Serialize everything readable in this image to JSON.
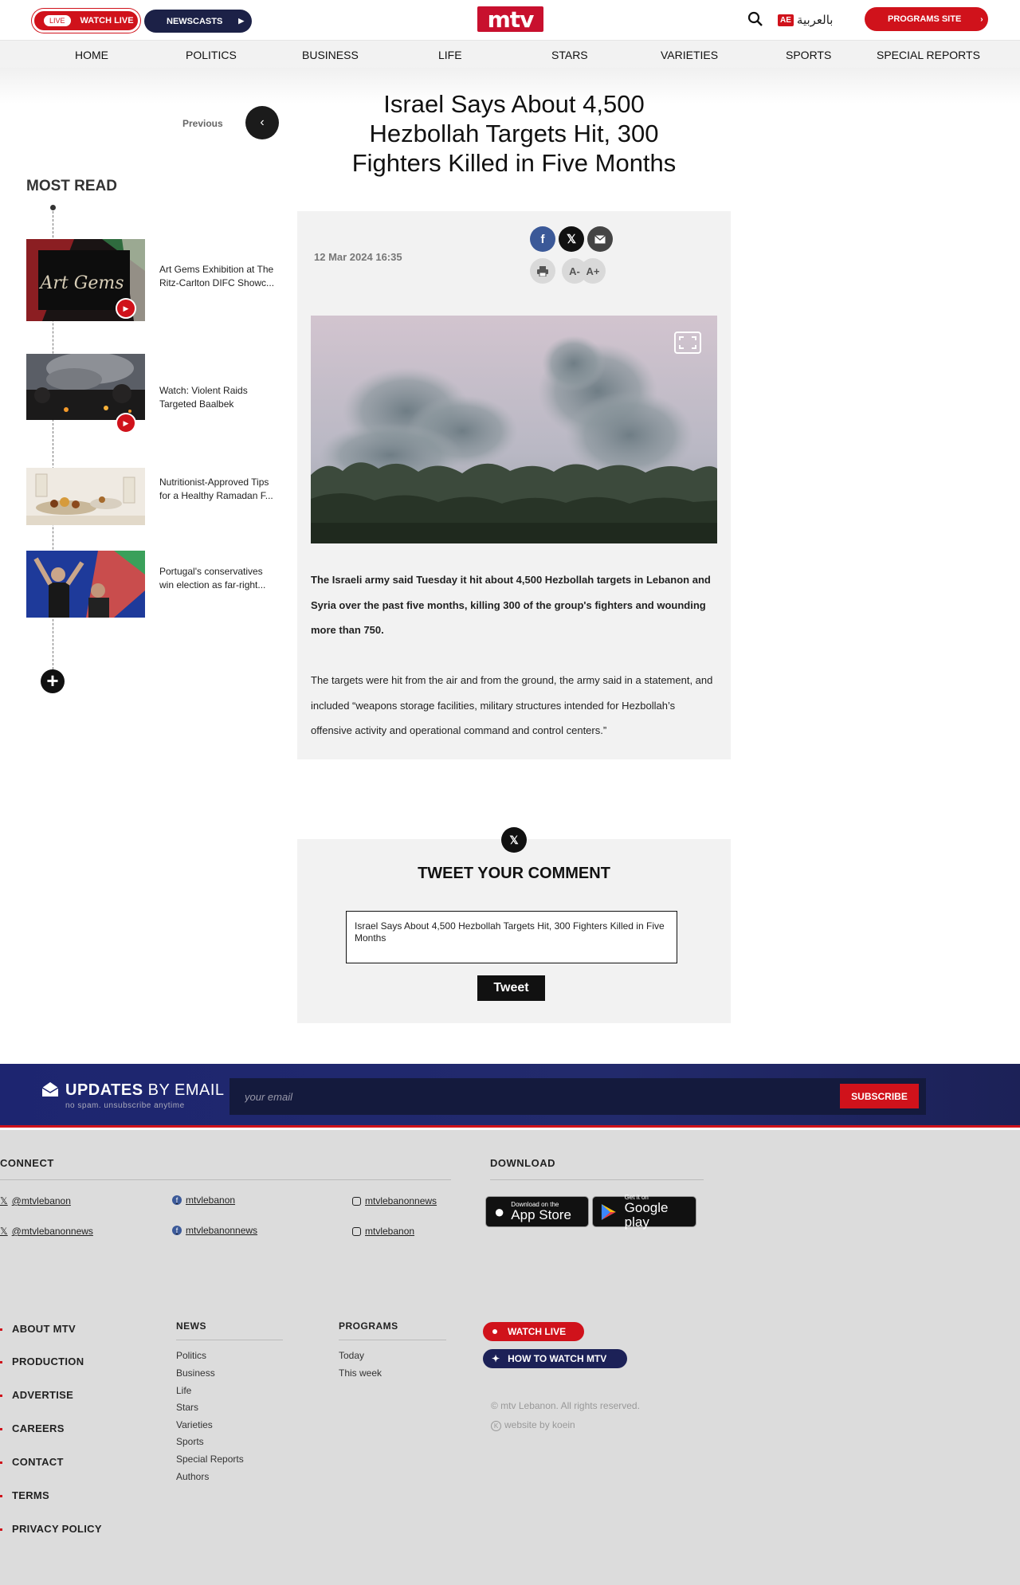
{
  "header": {
    "live_badge": "LIVE",
    "watch_live": "WATCH LIVE",
    "newscasts": "NEWSCASTS",
    "logo": "mtv",
    "arabic_badge": "AE",
    "arabic_label": "بالعربية",
    "programs_site": "PROGRAMS SITE",
    "brand_color": "#d0121b",
    "navy_color": "#1c2147"
  },
  "nav": {
    "items": [
      "HOME",
      "POLITICS",
      "BUSINESS",
      "LIFE",
      "STARS",
      "VARIETIES",
      "SPORTS",
      "SPECIAL REPORTS"
    ]
  },
  "article": {
    "previous_label": "Previous",
    "title": "Israel Says About 4,500 Hezbollah Targets Hit, 300 Fighters Killed in Five Months",
    "date": "12 Mar 2024 16:35",
    "font_decrease": "A-",
    "font_increase": "A+",
    "lead": "The Israeli army said Tuesday it hit about 4,500 Hezbollah targets in Lebanon and Syria over the past five months, killing 300 of the group's fighters and wounding more than 750.",
    "body": "The targets were hit from the air and from the ground, the army said in a statement, and included “weapons storage facilities, military structures intended for Hezbollah’s offensive activity and operational command and control centers.”"
  },
  "most_read": {
    "title": "MOST READ",
    "items": [
      {
        "text": "Art Gems Exhibition at The Ritz-Carlton DIFC Showc...",
        "has_video": true
      },
      {
        "text": "Watch: Violent Raids Targeted Baalbek",
        "has_video": true
      },
      {
        "text": "Nutritionist-Approved Tips for a Healthy Ramadan F...",
        "has_video": false
      },
      {
        "text": "Portugal's conservatives win election as far-right...",
        "has_video": false
      }
    ],
    "thumb_art_script": "Art Gems"
  },
  "tweet": {
    "title": "TWEET YOUR COMMENT",
    "text": "Israel Says About 4,500 Hezbollah Targets Hit, 300 Fighters Killed in Five Months",
    "button": "Tweet"
  },
  "newsletter": {
    "title_bold": "UPDATES",
    "title_rest": " BY EMAIL",
    "subtitle": "no spam. unsubscribe anytime",
    "placeholder": "your email",
    "button": "SUBSCRIBE"
  },
  "footer": {
    "connect_title": "CONNECT",
    "download_title": "DOWNLOAD",
    "social": [
      {
        "icon": "x-icon",
        "handle": "@mtvlebanon"
      },
      {
        "icon": "facebook-icon",
        "handle": "mtvlebanon"
      },
      {
        "icon": "instagram-icon",
        "handle": "mtvlebanonnews"
      },
      {
        "icon": "x-icon",
        "handle": "@mtvlebanonnews"
      },
      {
        "icon": "facebook-icon",
        "handle": "mtvlebanonnews"
      },
      {
        "icon": "instagram-icon",
        "handle": "mtvlebanon"
      }
    ],
    "app_store_small": "Download on the",
    "app_store_big": "App Store",
    "google_small": "Get it on",
    "google_big": "Google play",
    "main_links": [
      "ABOUT MTV",
      "PRODUCTION",
      "ADVERTISE",
      "CAREERS",
      "CONTACT",
      "TERMS",
      "PRIVACY POLICY"
    ],
    "news_title": "NEWS",
    "news_links": [
      "Politics",
      "Business",
      "Life",
      "Stars",
      "Varieties",
      "Sports",
      "Special Reports",
      "Authors"
    ],
    "programs_title": "PROGRAMS",
    "programs_links": [
      "Today",
      "This week"
    ],
    "watch_live": "WATCH LIVE",
    "how_to_watch": "HOW TO WATCH MTV",
    "copyright": "© mtv Lebanon. All rights reserved.",
    "credit": "website by koein"
  }
}
